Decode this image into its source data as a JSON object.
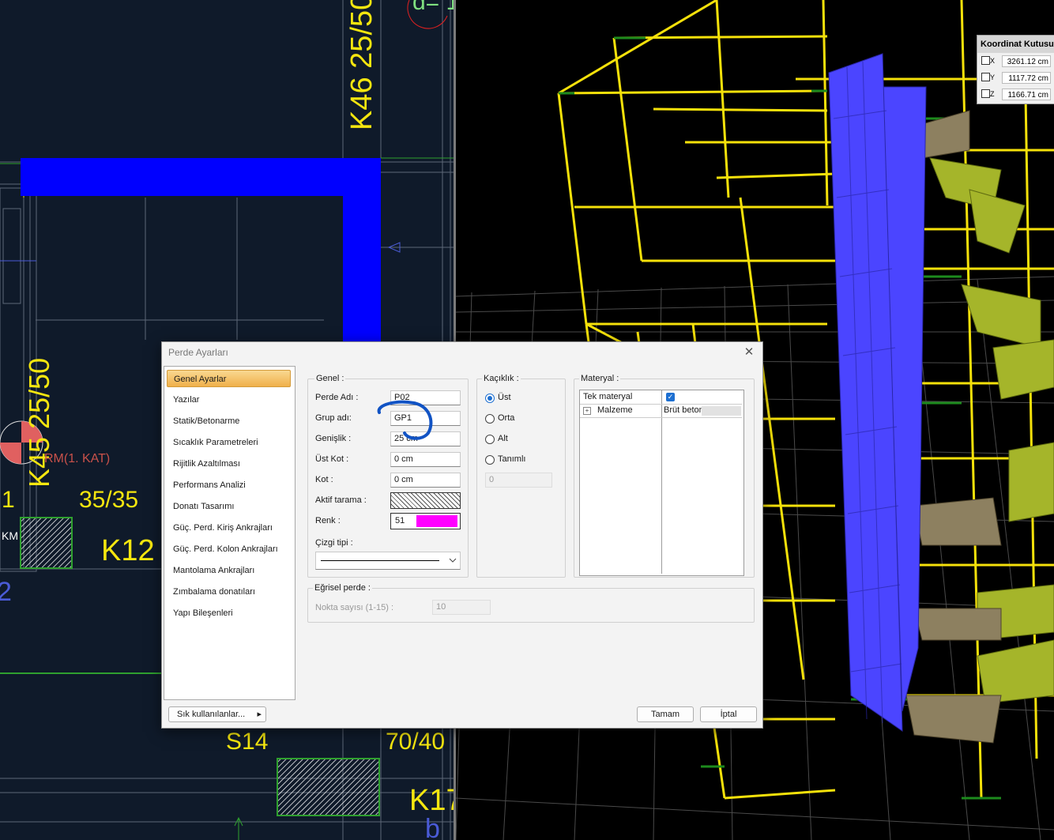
{
  "cad": {
    "labels": {
      "k46": "K46 25/50",
      "k45": "K45 25/50",
      "d1": "d= 1",
      "kat": "RM(1. KAT)",
      "dim1": "35/35",
      "num1": "1",
      "k12": "K12",
      "km": "KM",
      "num2": "2",
      "s14": "S14",
      "dim2": "70/40",
      "k17": "K17",
      "b": "b"
    },
    "colors": {
      "background": "#0f1a2a",
      "text": "#f5e60f",
      "wall": "#0000ff"
    }
  },
  "view3d": {
    "colors": {
      "frame": "#f5e10a",
      "shear_wall": "#4b45ff",
      "slab": "#a5b52a",
      "support": "#1d8a1d"
    }
  },
  "coord_box": {
    "title": "Koordinat Kutusu",
    "rows": [
      {
        "label": "X",
        "value": "3261.12 cm"
      },
      {
        "label": "Y",
        "value": "1117.72 cm"
      },
      {
        "label": "Z",
        "value": "1166.71 cm"
      }
    ]
  },
  "dialog": {
    "title": "Perde Ayarları",
    "close_label": "✕",
    "nav": [
      "Genel Ayarlar",
      "Yazılar",
      "Statik/Betonarme",
      "Sıcaklık Parametreleri",
      "Rijitlik Azaltılması",
      "Performans Analizi",
      "Donatı Tasarımı",
      "Güç. Perd. Kiriş Ankrajları",
      "Güç. Perd. Kolon Ankrajları",
      "Mantolama Ankrajları",
      "Zımbalama donatıları",
      "Yapı Bileşenleri"
    ],
    "genel": {
      "title": "Genel :",
      "perde_adi_label": "Perde Adı :",
      "perde_adi": "P02",
      "grup_adi_label": "Grup adı:",
      "grup_adi": "GP1",
      "genislik_label": "Genişlik :",
      "genislik": "25 cm",
      "ust_kot_label": "Üst Kot :",
      "ust_kot": "0 cm",
      "kot_label": "Kot :",
      "kot": "0 cm",
      "aktif_tarama_label": "Aktif tarama :",
      "renk_label": "Renk :",
      "renk_value": "51",
      "renk_color": "#ff00ff",
      "cizgi_tipi_label": "Çizgi tipi :"
    },
    "kaciklik": {
      "title": "Kaçıklık :",
      "options": [
        "Üst",
        "Orta",
        "Alt",
        "Tanımlı"
      ],
      "selected": "Üst",
      "value": "0"
    },
    "materyal": {
      "title": "Materyal :",
      "tek_materyal_label": "Tek materyal",
      "tek_materyal_checked": true,
      "malzeme_label": "Malzeme",
      "malzeme_value": "Brüt beton",
      "expand_glyph": "+"
    },
    "egrisel": {
      "title": "Eğrisel perde :",
      "nokta_label": "Nokta sayısı (1-15) :",
      "nokta_value": "10"
    },
    "buttons": {
      "sik": "Sık kullanılanlar...",
      "sik_arrow": "▸",
      "tamam": "Tamam",
      "iptal": "İptal"
    }
  }
}
